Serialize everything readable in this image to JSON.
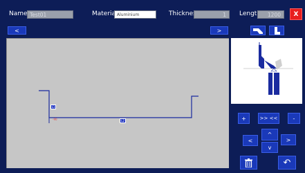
{
  "header": {
    "name_label": "Name",
    "name_value": "Test01",
    "material_label": "Material",
    "material_value": "Aluminium",
    "thickness_label": "Thickness",
    "thickness_value": "1",
    "length_label": "Length",
    "length_value": "1200",
    "close_label": "X"
  },
  "toolbar": {
    "prev_label": "<",
    "next_label": ">"
  },
  "drawing": {
    "segment_l1": "L1",
    "segment_l2": "L2",
    "angle_text": "-90"
  },
  "controls": {
    "plus": "+",
    "squeeze": ">> <<",
    "minus": "-",
    "up": "^",
    "left": "<",
    "right": ">",
    "down": "v",
    "undo": "↶"
  },
  "colors": {
    "background": "#0d1d57",
    "button": "#1a39b9",
    "close": "#e81f1f",
    "canvas": "#c6c6c6"
  }
}
